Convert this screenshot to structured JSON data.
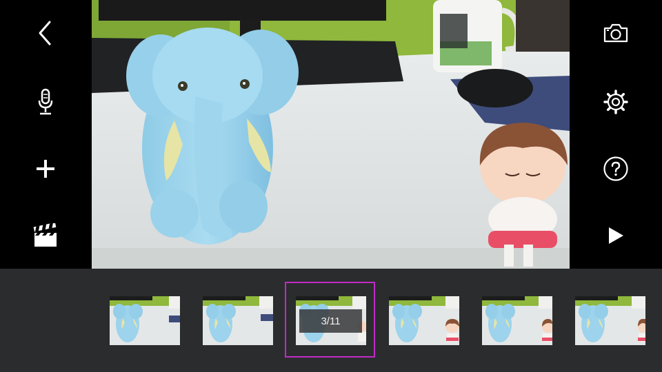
{
  "left_toolbar": {
    "items": [
      {
        "name": "back",
        "icon": "chevron-left-icon"
      },
      {
        "name": "record-audio",
        "icon": "microphone-icon"
      },
      {
        "name": "add",
        "icon": "plus-icon"
      },
      {
        "name": "clapperboard",
        "icon": "clapperboard-icon"
      }
    ]
  },
  "right_toolbar": {
    "items": [
      {
        "name": "capture",
        "icon": "camera-icon"
      },
      {
        "name": "settings",
        "icon": "gear-icon"
      },
      {
        "name": "help",
        "icon": "help-icon"
      },
      {
        "name": "play",
        "icon": "play-icon"
      }
    ]
  },
  "preview": {
    "frame_index": 3,
    "frame_total": 11
  },
  "timeline": {
    "counter_text": "3/11",
    "selected_index": 2,
    "thumbnail_count": 6
  },
  "colors": {
    "background": "#000000",
    "strip": "#2b2c2e",
    "selection": "#c12bc8",
    "icon": "#ffffff"
  }
}
